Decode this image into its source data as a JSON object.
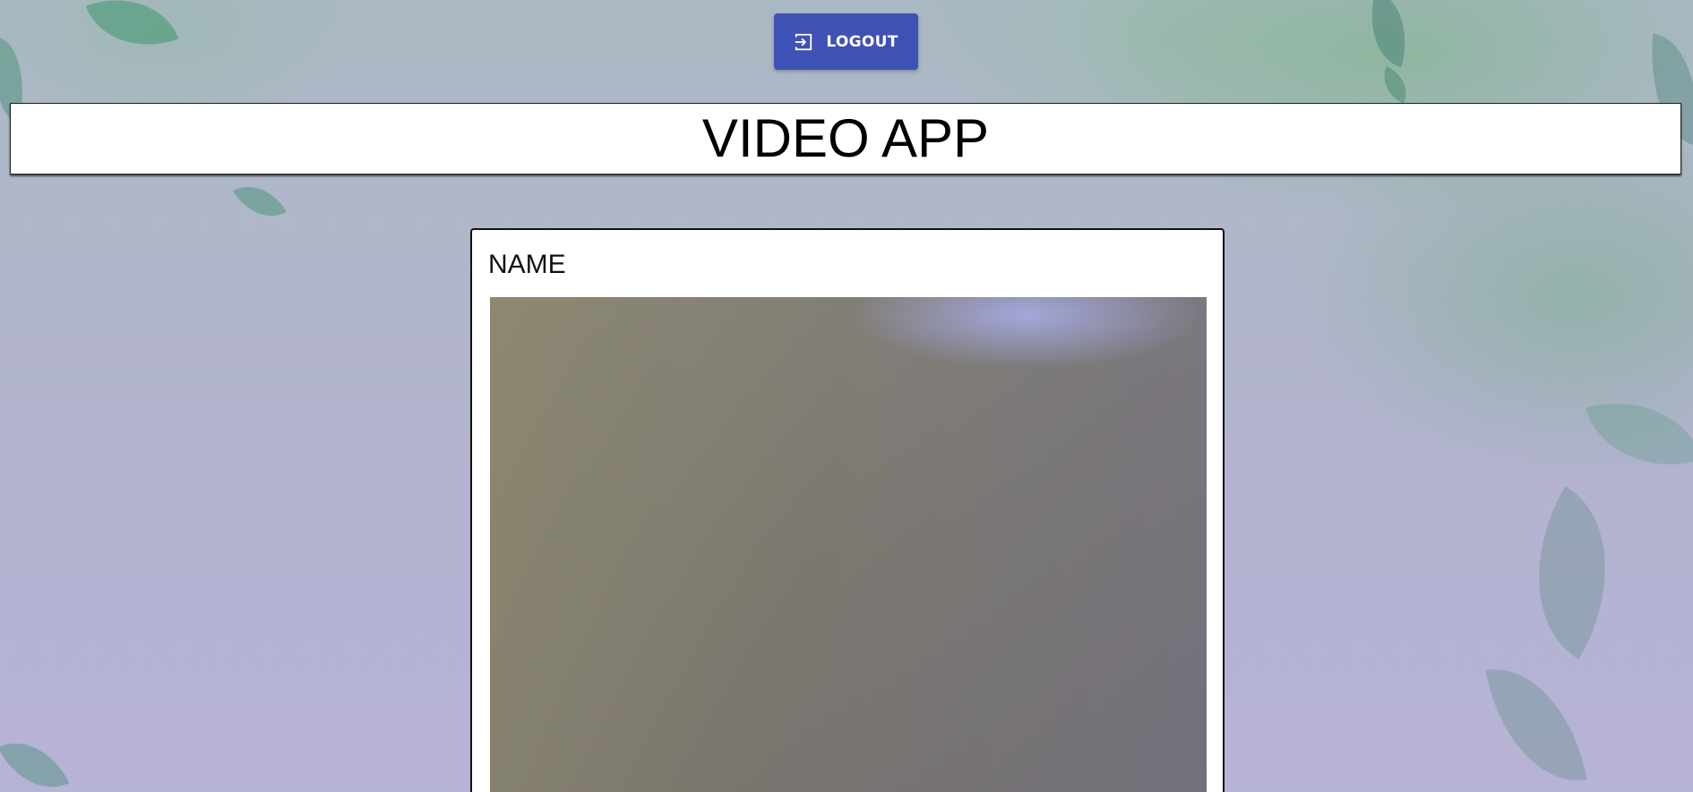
{
  "toolbar": {
    "logout_label": "LOGOUT",
    "logout_icon": "logout-icon"
  },
  "header": {
    "title": "VIDEO APP"
  },
  "video_card": {
    "name_label": "NAME"
  },
  "colors": {
    "button_bg": "#3f51b5",
    "button_text": "#ffffff",
    "header_bg": "#ffffff",
    "card_bg": "#ffffff"
  }
}
